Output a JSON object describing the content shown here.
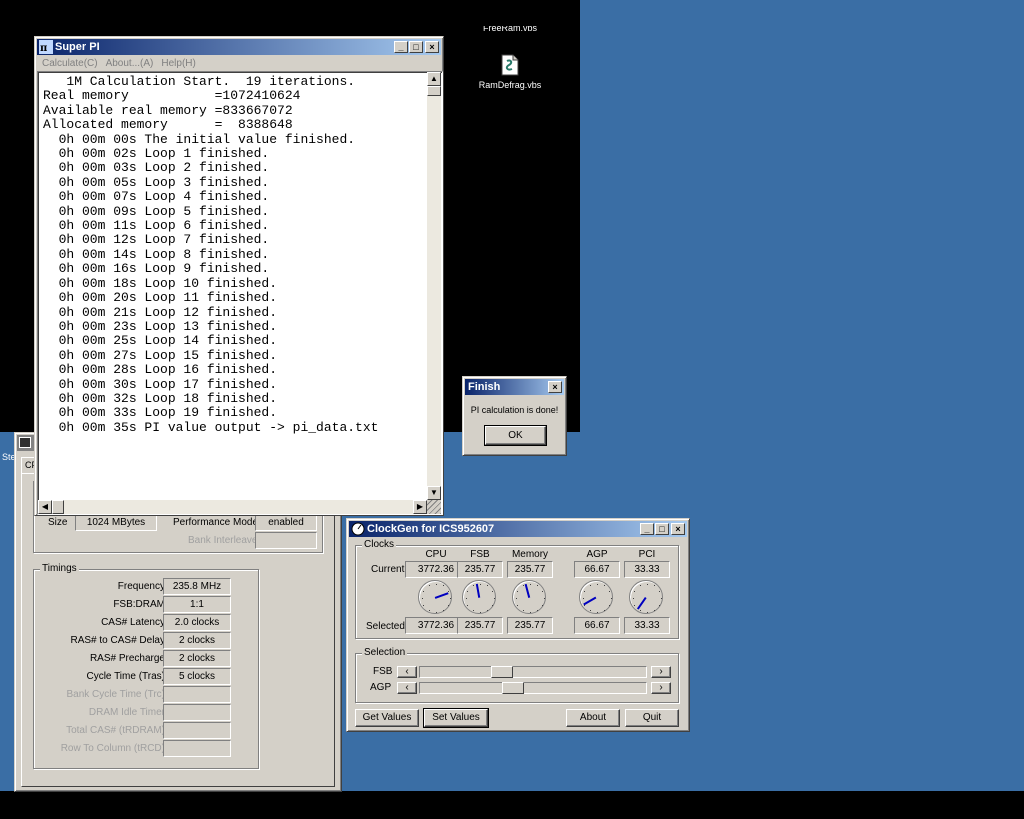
{
  "desktop": {
    "icon_top_label_cut": "FreeRam.vbs",
    "icon_label": "RamDefrag.vbs",
    "left_edge_text": "Ste"
  },
  "superpi": {
    "title": "Super PI",
    "menu": [
      "Calculate(C)",
      "About...(A)",
      "Help(H)"
    ],
    "lines": [
      "   1M Calculation Start.  19 iterations.",
      "Real memory           =1072410624",
      "Available real memory =833667072",
      "Allocated memory      =  8388648",
      "  0h 00m 00s The initial value finished.",
      "  0h 00m 02s Loop 1 finished.",
      "  0h 00m 03s Loop 2 finished.",
      "  0h 00m 05s Loop 3 finished.",
      "  0h 00m 07s Loop 4 finished.",
      "  0h 00m 09s Loop 5 finished.",
      "  0h 00m 11s Loop 6 finished.",
      "  0h 00m 12s Loop 7 finished.",
      "  0h 00m 14s Loop 8 finished.",
      "  0h 00m 16s Loop 9 finished.",
      "  0h 00m 18s Loop 10 finished.",
      "  0h 00m 20s Loop 11 finished.",
      "  0h 00m 21s Loop 12 finished.",
      "  0h 00m 23s Loop 13 finished.",
      "  0h 00m 25s Loop 14 finished.",
      "  0h 00m 27s Loop 15 finished.",
      "  0h 00m 28s Loop 16 finished.",
      "  0h 00m 30s Loop 17 finished.",
      "  0h 00m 32s Loop 18 finished.",
      "  0h 00m 33s Loop 19 finished.",
      "  0h 00m 35s PI value output -> pi_data.txt"
    ]
  },
  "finish_dialog": {
    "title": "Finish",
    "message": "PI calculation is done!",
    "ok_label": "OK"
  },
  "cpuz": {
    "tab_partial": "CP",
    "memory": {
      "size_label": "Size",
      "size_value": "1024 MBytes",
      "perf_label": "Performance Mode",
      "perf_value": "enabled",
      "bank_label": "Bank Interleave",
      "bank_value": ""
    },
    "timings": {
      "group_label": "Timings",
      "rows": [
        {
          "label": "Frequency",
          "value": "235.8 MHz",
          "enabled": true
        },
        {
          "label": "FSB:DRAM",
          "value": "1:1",
          "enabled": true
        },
        {
          "label": "CAS# Latency",
          "value": "2.0 clocks",
          "enabled": true
        },
        {
          "label": "RAS# to CAS# Delay",
          "value": "2 clocks",
          "enabled": true
        },
        {
          "label": "RAS# Precharge",
          "value": "2 clocks",
          "enabled": true
        },
        {
          "label": "Cycle Time (Tras)",
          "value": "5 clocks",
          "enabled": true
        },
        {
          "label": "Bank Cycle Time (Trc)",
          "value": "",
          "enabled": false
        },
        {
          "label": "DRAM Idle Timer",
          "value": "",
          "enabled": false
        },
        {
          "label": "Total CAS# (tRDRAM)",
          "value": "",
          "enabled": false
        },
        {
          "label": "Row To Column (tRCD)",
          "value": "",
          "enabled": false
        }
      ]
    }
  },
  "clockgen": {
    "title": "ClockGen for ICS952607",
    "clocks_label": "Clocks",
    "columns": [
      "CPU",
      "FSB",
      "Memory",
      "AGP",
      "PCI"
    ],
    "current_label": "Current",
    "current": [
      "3772.36",
      "235.77",
      "235.77",
      "66.67",
      "33.33"
    ],
    "selected_label": "Selected",
    "selected": [
      "3772.36",
      "235.77",
      "235.77",
      "66.67",
      "33.33"
    ],
    "dial_angles_deg": [
      -20,
      -100,
      -105,
      150,
      125
    ],
    "selection_label": "Selection",
    "fsb_label": "FSB",
    "agp_label": "AGP",
    "fsb_position": 0.35,
    "agp_position": 0.4,
    "buttons": {
      "get_values": "Get Values",
      "set_values": "Set Values",
      "about": "About",
      "quit": "Quit"
    }
  }
}
